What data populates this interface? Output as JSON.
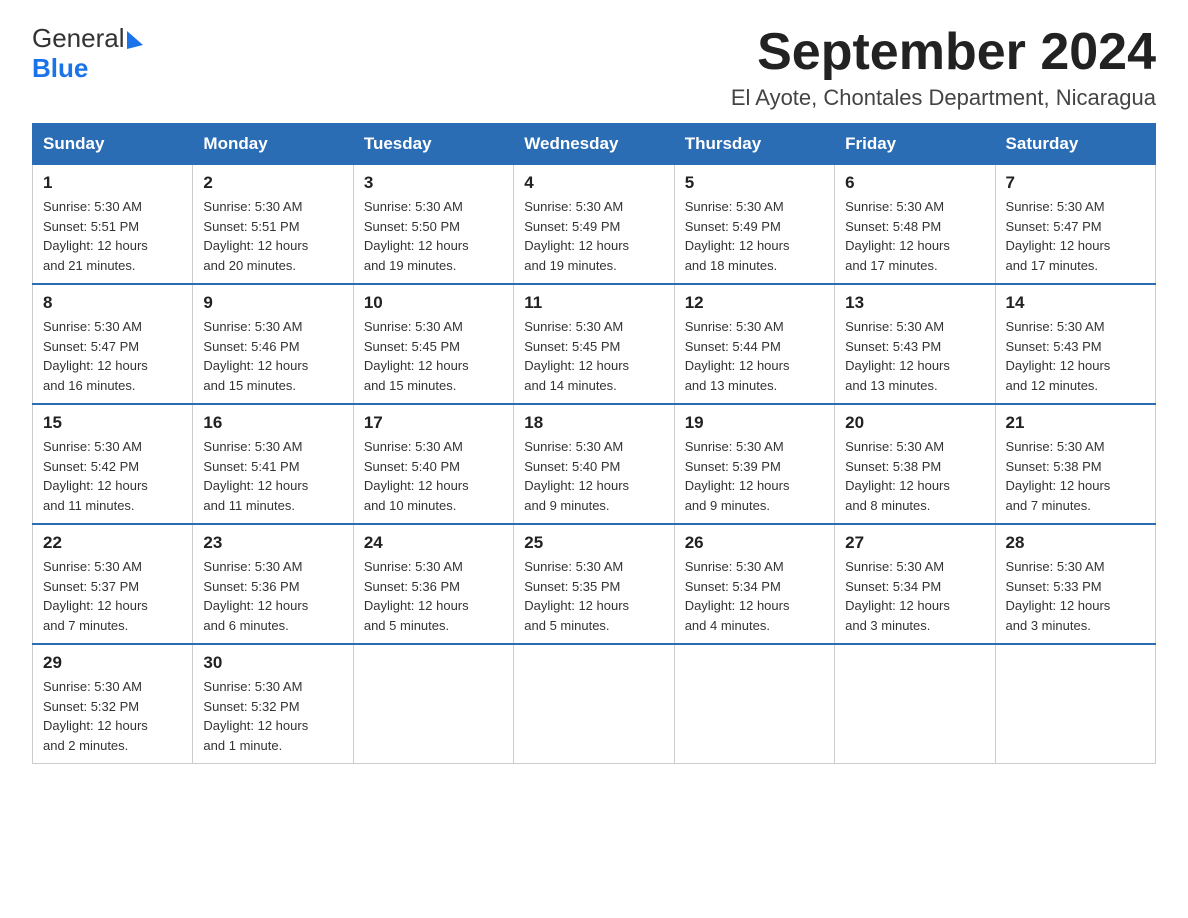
{
  "logo": {
    "text_general": "General",
    "text_blue": "Blue",
    "triangle_char": "▶"
  },
  "title": "September 2024",
  "subtitle": "El Ayote, Chontales Department, Nicaragua",
  "days_of_week": [
    "Sunday",
    "Monday",
    "Tuesday",
    "Wednesday",
    "Thursday",
    "Friday",
    "Saturday"
  ],
  "weeks": [
    [
      {
        "day": "1",
        "info": "Sunrise: 5:30 AM\nSunset: 5:51 PM\nDaylight: 12 hours\nand 21 minutes."
      },
      {
        "day": "2",
        "info": "Sunrise: 5:30 AM\nSunset: 5:51 PM\nDaylight: 12 hours\nand 20 minutes."
      },
      {
        "day": "3",
        "info": "Sunrise: 5:30 AM\nSunset: 5:50 PM\nDaylight: 12 hours\nand 19 minutes."
      },
      {
        "day": "4",
        "info": "Sunrise: 5:30 AM\nSunset: 5:49 PM\nDaylight: 12 hours\nand 19 minutes."
      },
      {
        "day": "5",
        "info": "Sunrise: 5:30 AM\nSunset: 5:49 PM\nDaylight: 12 hours\nand 18 minutes."
      },
      {
        "day": "6",
        "info": "Sunrise: 5:30 AM\nSunset: 5:48 PM\nDaylight: 12 hours\nand 17 minutes."
      },
      {
        "day": "7",
        "info": "Sunrise: 5:30 AM\nSunset: 5:47 PM\nDaylight: 12 hours\nand 17 minutes."
      }
    ],
    [
      {
        "day": "8",
        "info": "Sunrise: 5:30 AM\nSunset: 5:47 PM\nDaylight: 12 hours\nand 16 minutes."
      },
      {
        "day": "9",
        "info": "Sunrise: 5:30 AM\nSunset: 5:46 PM\nDaylight: 12 hours\nand 15 minutes."
      },
      {
        "day": "10",
        "info": "Sunrise: 5:30 AM\nSunset: 5:45 PM\nDaylight: 12 hours\nand 15 minutes."
      },
      {
        "day": "11",
        "info": "Sunrise: 5:30 AM\nSunset: 5:45 PM\nDaylight: 12 hours\nand 14 minutes."
      },
      {
        "day": "12",
        "info": "Sunrise: 5:30 AM\nSunset: 5:44 PM\nDaylight: 12 hours\nand 13 minutes."
      },
      {
        "day": "13",
        "info": "Sunrise: 5:30 AM\nSunset: 5:43 PM\nDaylight: 12 hours\nand 13 minutes."
      },
      {
        "day": "14",
        "info": "Sunrise: 5:30 AM\nSunset: 5:43 PM\nDaylight: 12 hours\nand 12 minutes."
      }
    ],
    [
      {
        "day": "15",
        "info": "Sunrise: 5:30 AM\nSunset: 5:42 PM\nDaylight: 12 hours\nand 11 minutes."
      },
      {
        "day": "16",
        "info": "Sunrise: 5:30 AM\nSunset: 5:41 PM\nDaylight: 12 hours\nand 11 minutes."
      },
      {
        "day": "17",
        "info": "Sunrise: 5:30 AM\nSunset: 5:40 PM\nDaylight: 12 hours\nand 10 minutes."
      },
      {
        "day": "18",
        "info": "Sunrise: 5:30 AM\nSunset: 5:40 PM\nDaylight: 12 hours\nand 9 minutes."
      },
      {
        "day": "19",
        "info": "Sunrise: 5:30 AM\nSunset: 5:39 PM\nDaylight: 12 hours\nand 9 minutes."
      },
      {
        "day": "20",
        "info": "Sunrise: 5:30 AM\nSunset: 5:38 PM\nDaylight: 12 hours\nand 8 minutes."
      },
      {
        "day": "21",
        "info": "Sunrise: 5:30 AM\nSunset: 5:38 PM\nDaylight: 12 hours\nand 7 minutes."
      }
    ],
    [
      {
        "day": "22",
        "info": "Sunrise: 5:30 AM\nSunset: 5:37 PM\nDaylight: 12 hours\nand 7 minutes."
      },
      {
        "day": "23",
        "info": "Sunrise: 5:30 AM\nSunset: 5:36 PM\nDaylight: 12 hours\nand 6 minutes."
      },
      {
        "day": "24",
        "info": "Sunrise: 5:30 AM\nSunset: 5:36 PM\nDaylight: 12 hours\nand 5 minutes."
      },
      {
        "day": "25",
        "info": "Sunrise: 5:30 AM\nSunset: 5:35 PM\nDaylight: 12 hours\nand 5 minutes."
      },
      {
        "day": "26",
        "info": "Sunrise: 5:30 AM\nSunset: 5:34 PM\nDaylight: 12 hours\nand 4 minutes."
      },
      {
        "day": "27",
        "info": "Sunrise: 5:30 AM\nSunset: 5:34 PM\nDaylight: 12 hours\nand 3 minutes."
      },
      {
        "day": "28",
        "info": "Sunrise: 5:30 AM\nSunset: 5:33 PM\nDaylight: 12 hours\nand 3 minutes."
      }
    ],
    [
      {
        "day": "29",
        "info": "Sunrise: 5:30 AM\nSunset: 5:32 PM\nDaylight: 12 hours\nand 2 minutes."
      },
      {
        "day": "30",
        "info": "Sunrise: 5:30 AM\nSunset: 5:32 PM\nDaylight: 12 hours\nand 1 minute."
      },
      {
        "day": "",
        "info": ""
      },
      {
        "day": "",
        "info": ""
      },
      {
        "day": "",
        "info": ""
      },
      {
        "day": "",
        "info": ""
      },
      {
        "day": "",
        "info": ""
      }
    ]
  ]
}
